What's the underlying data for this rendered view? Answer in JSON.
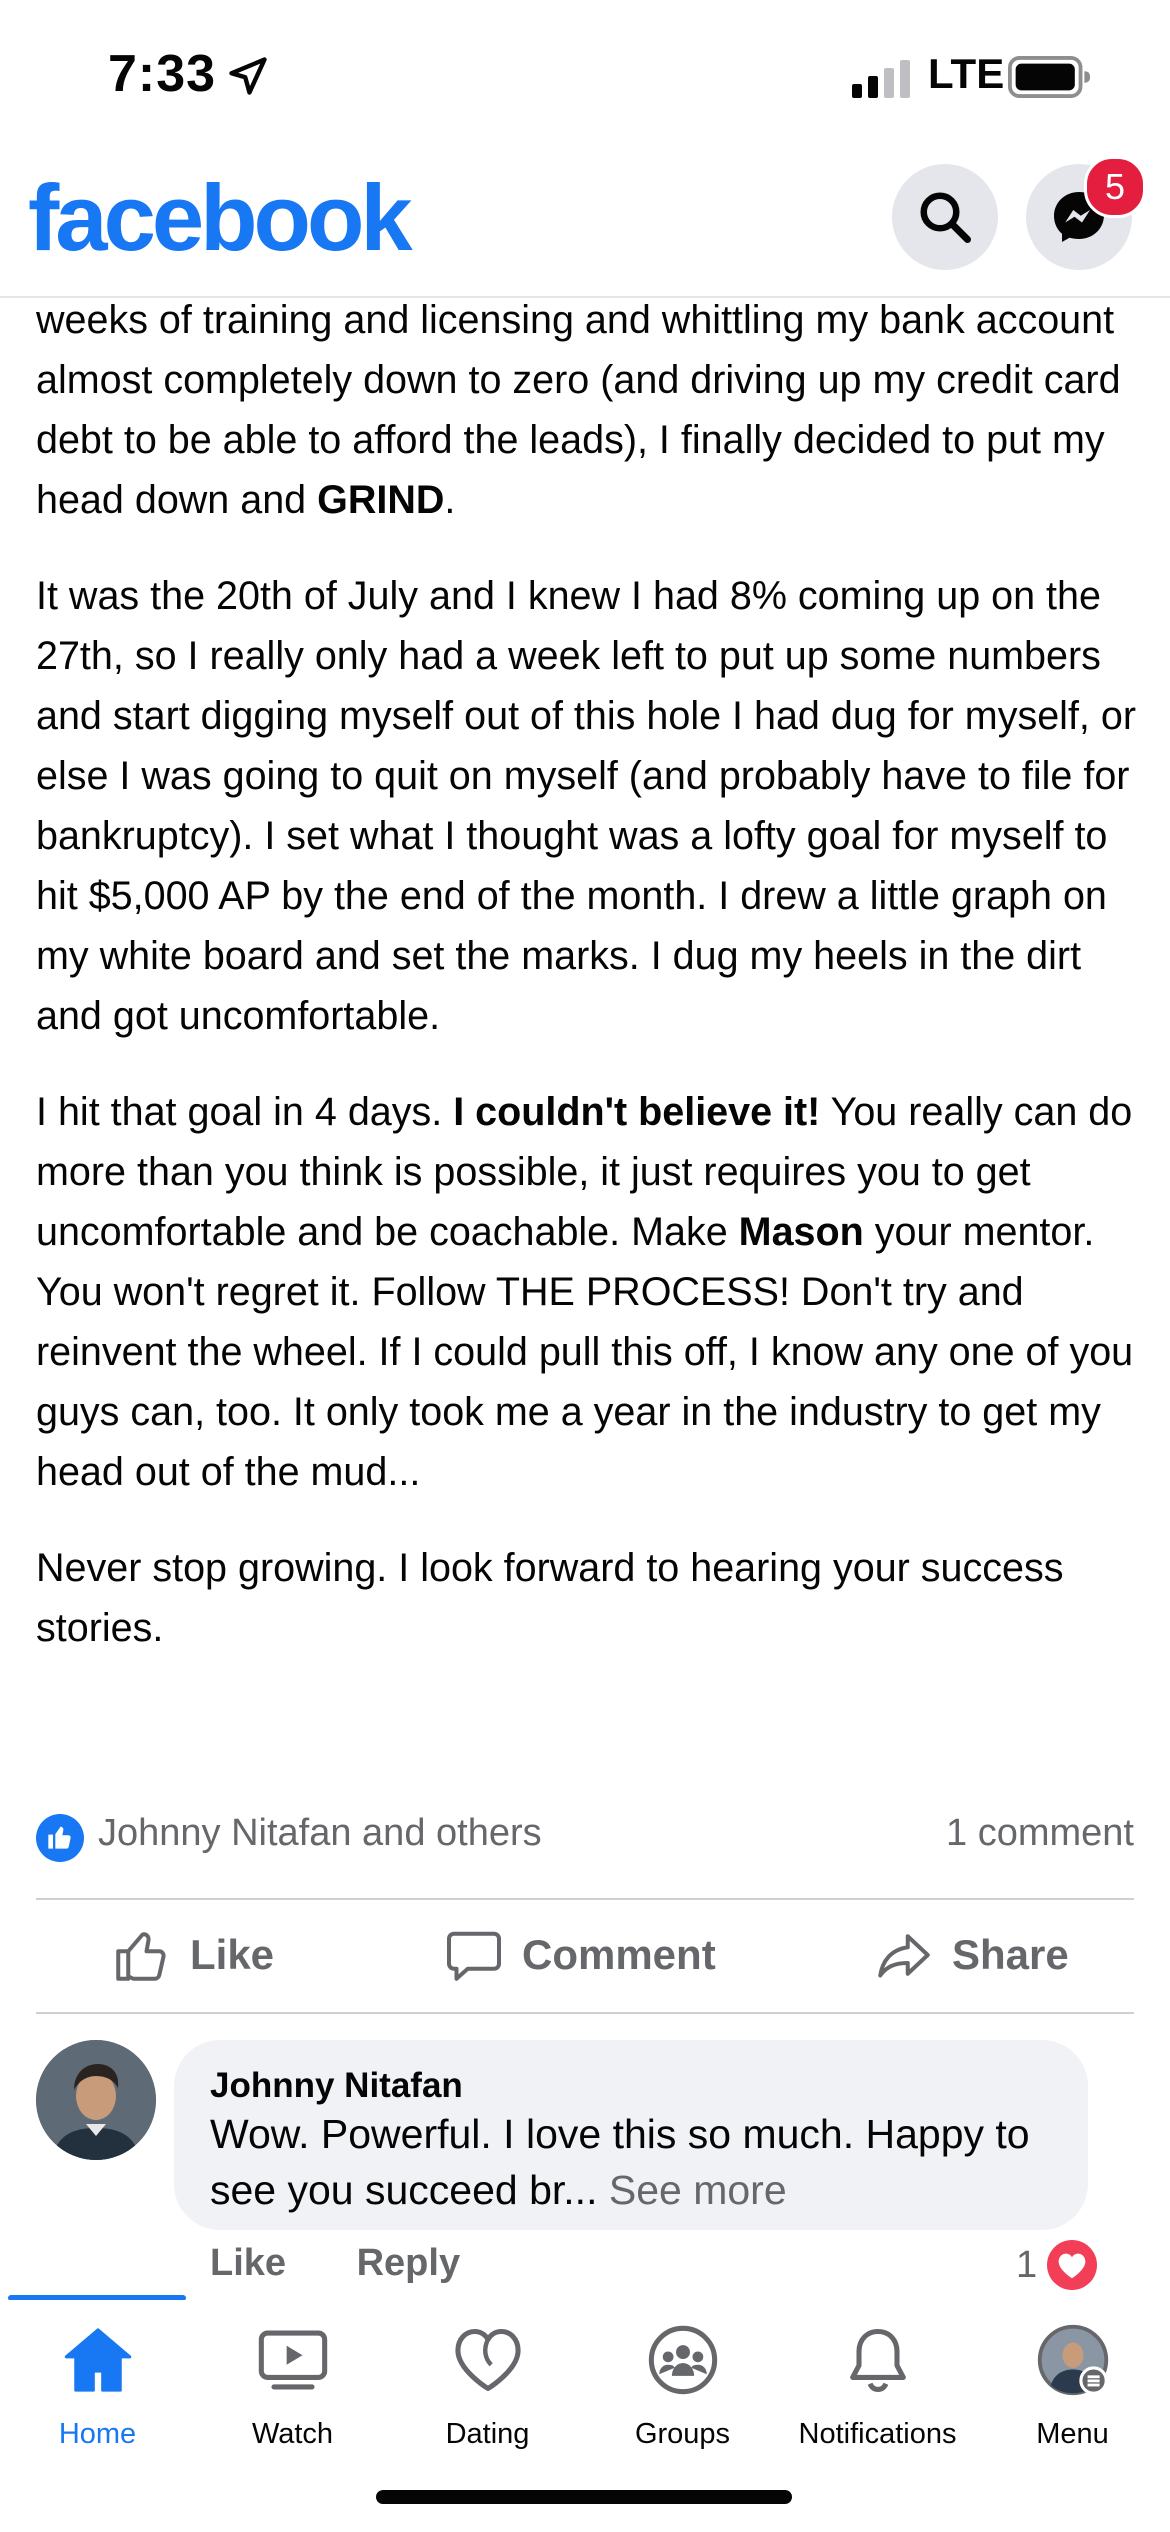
{
  "status_bar": {
    "time": "7:33",
    "network": "LTE"
  },
  "header": {
    "logo": "facebook",
    "messenger_badge": "5"
  },
  "post": {
    "paragraphs": [
      [
        "weeks of training and licensing and whittling my bank account almost completely down to zero (and driving up my credit card debt to be able to afford the leads), I finally decided to put my head down and ",
        "GRIND",
        "."
      ],
      [
        "It was the 20th of July and I knew I had 8% coming up on the 27th, so I really only had a week left to put up some numbers and start digging myself out of this hole I had dug for myself, or else I was going to quit on myself (and probably have to file for bankruptcy). I set what I thought was a lofty goal for myself to hit $5,000 AP by the end of the month. I drew a little graph on my white board and set the marks. I dug my heels in the dirt and got uncomfortable."
      ],
      [
        "I hit that goal in 4 days. ",
        "I couldn't believe it!",
        " You really can do more than you think is possible, it just requires you to get uncomfortable and be coachable. Make ",
        "Mason",
        " your mentor. You won't regret it. Follow THE PROCESS! Don't try and reinvent the wheel. If I could pull this off, I know any one of you guys can, too. It only took me a year in the industry to get my head out of the mud..."
      ],
      [
        "Never stop growing. I look forward to hearing your success stories."
      ]
    ],
    "reaction_names": "Johnny Nitafan and others",
    "comment_count": "1 comment",
    "actions": {
      "like": "Like",
      "comment": "Comment",
      "share": "Share"
    }
  },
  "comment": {
    "author": "Johnny Nitafan",
    "text": "Wow. Powerful. I love this so much. Happy to see you succeed br...",
    "see_more": "See more",
    "like_label": "Like",
    "reply_label": "Reply",
    "reaction_count": "1"
  },
  "bottom_nav": {
    "items": [
      {
        "label": "Home",
        "icon": "home-icon"
      },
      {
        "label": "Watch",
        "icon": "watch-icon"
      },
      {
        "label": "Dating",
        "icon": "heart-icon"
      },
      {
        "label": "Groups",
        "icon": "groups-icon"
      },
      {
        "label": "Notifications",
        "icon": "bell-icon"
      },
      {
        "label": "Menu",
        "icon": "avatar-menu-icon"
      }
    ]
  },
  "colors": {
    "brand": "#1877f2",
    "text": "#050505",
    "secondary_text": "#65676b",
    "badge": "#e41e3f",
    "love": "#f33e58"
  }
}
